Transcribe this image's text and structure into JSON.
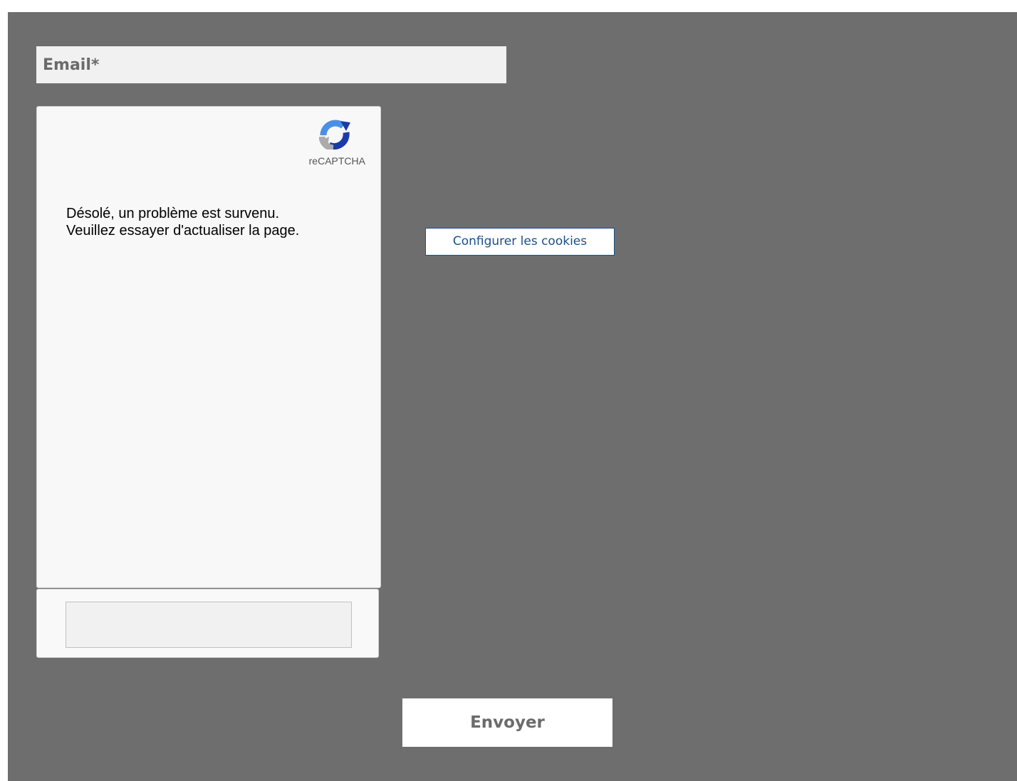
{
  "form": {
    "email_placeholder": "Email*",
    "email_value": "",
    "submit_label": "Envoyer"
  },
  "recaptcha": {
    "brand": "reCAPTCHA",
    "logo_icon": "recaptcha-logo-icon",
    "error_line1": "Désolé, un problème est survenu.",
    "error_line2": "Veuillez essayer d'actualiser la page.",
    "response_value": ""
  },
  "cookies": {
    "button_label": "Configurer les cookies"
  },
  "colors": {
    "page_background": "#6e6e6e",
    "field_background": "#f1f1f1",
    "link_blue": "#1a4f8b",
    "muted_text": "#6b6b6b"
  }
}
